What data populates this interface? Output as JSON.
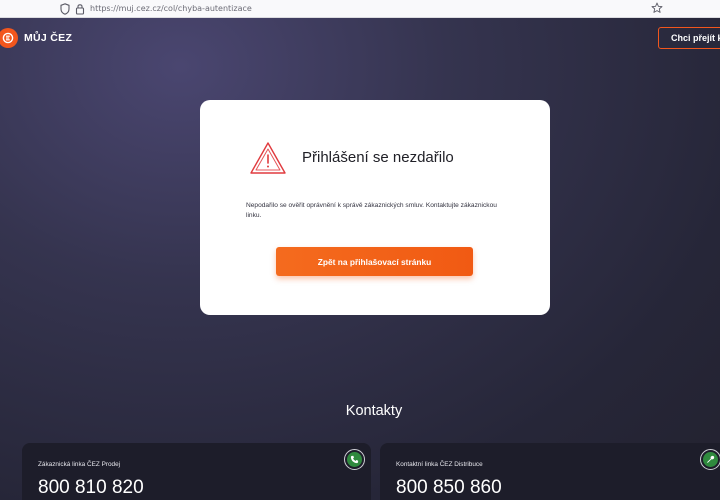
{
  "browser": {
    "url": "https://muj.cez.cz/col/chyba-autentizace"
  },
  "header": {
    "logo_text": "MŮJ ČEZ",
    "logo_letter": "E",
    "cta_label": "Chci přejít k"
  },
  "error_card": {
    "title": "Přihlášení se nezdařilo",
    "message": "Nepodařilo se ověřit oprávnění k správě zákaznických smluv. Kontaktujte zákaznickou linku.",
    "button_label": "Zpět na přihlašovací stránku",
    "icon": "warning-triangle-icon",
    "icon_color": "#e03a3e"
  },
  "contacts": {
    "title": "Kontakty",
    "items": [
      {
        "label": "Zákaznická linka ČEZ Prodej",
        "number": "800 810 820",
        "icon": "phone-icon"
      },
      {
        "label": "Kontaktní linka ČEZ Distribuce",
        "number": "800 850 860",
        "icon": "wrench-icon"
      }
    ]
  },
  "colors": {
    "accent": "#f2561d",
    "background": "#2a2a40",
    "card": "#ffffff",
    "contact_card": "#1d1d2a",
    "icon_green": "#2f8a3e"
  }
}
